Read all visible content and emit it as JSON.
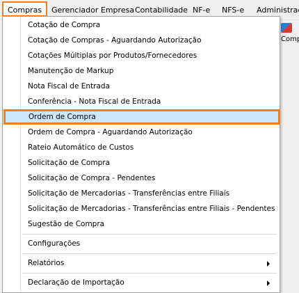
{
  "menubar": {
    "items": [
      {
        "label": "Compras"
      },
      {
        "label": "Gerenciador Empresa"
      },
      {
        "label": "Contabilidade"
      },
      {
        "label": "NF-e"
      },
      {
        "label": "NFS-e"
      },
      {
        "label": "Administração"
      }
    ]
  },
  "toolbar": {
    "partial_label": "Comp"
  },
  "dropdown": {
    "items": [
      {
        "label": "Cotação de Compra"
      },
      {
        "label": "Cotação de Compras - Aguardando Autorização"
      },
      {
        "label": "Cotações Múltiplas por Produtos/Fornecedores"
      },
      {
        "label": "Manutenção de Markup"
      },
      {
        "label": "Nota Fiscal de Entrada"
      },
      {
        "label": "Conferência - Nota Fiscal de Entrada"
      },
      {
        "label": "Ordem de Compra"
      },
      {
        "label": "Ordem de Compra - Aguardando Autorização"
      },
      {
        "label": "Rateio Automático de Custos"
      },
      {
        "label": "Solicitação de Compra"
      },
      {
        "label": "Solicitação de Compra - Pendentes"
      },
      {
        "label": "Solicitação de Mercadorias - Transferências entre Filiais"
      },
      {
        "label": "Solicitação de Mercadorias - Transferências entre Filiais - Pendentes"
      },
      {
        "label": "Sugestão de Compra"
      },
      {
        "label": "Configurações"
      },
      {
        "label": "Relatórios"
      },
      {
        "label": "Declaração de Importação"
      }
    ]
  },
  "colors": {
    "highlight_border": "#f07d1e",
    "highlight_fill": "#cce8ff",
    "menu_background": "#f0f0f0"
  }
}
